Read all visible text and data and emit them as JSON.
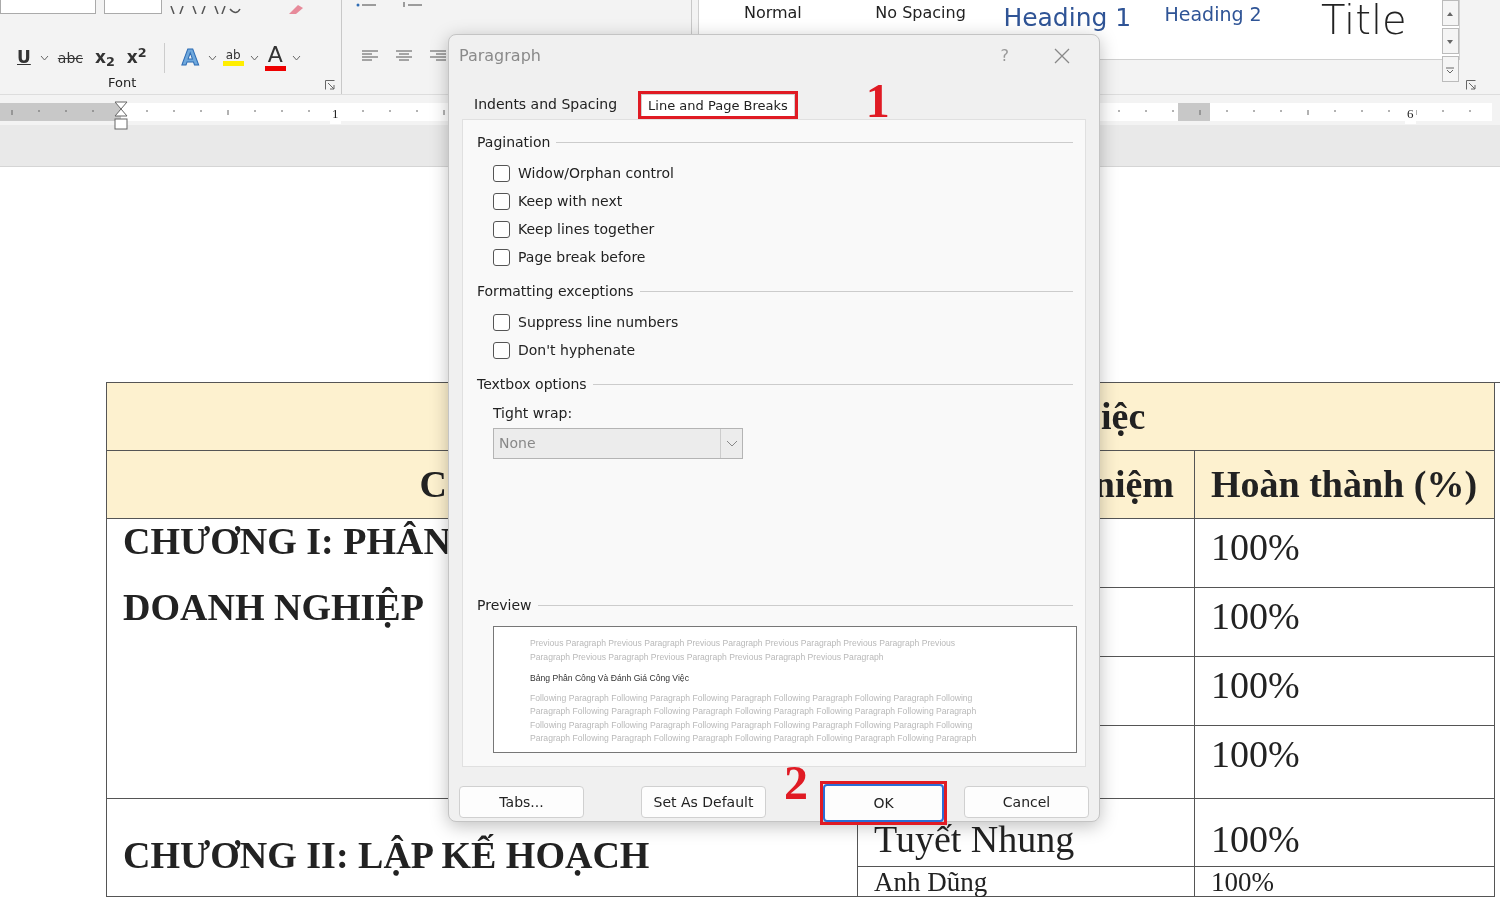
{
  "ribbon": {
    "font_group": {
      "label": "Font",
      "buttons": [
        {
          "kind": "underline",
          "label": "U",
          "has_menu": true
        },
        {
          "kind": "strike",
          "label": "abc",
          "has_menu": false
        },
        {
          "kind": "sub",
          "label": "x$_{2}$",
          "has_menu": false
        },
        {
          "kind": "super",
          "label": "x$^{2}$",
          "has_menu": false
        },
        {
          "kind": "effects",
          "label": "A",
          "has_menu": true
        },
        {
          "kind": "highlight",
          "label": "ab",
          "has_menu": true
        },
        {
          "kind": "fontcolor",
          "label": "A",
          "has_menu": true
        }
      ]
    },
    "styles": [
      {
        "kind": "normal",
        "name": "Normal"
      },
      {
        "kind": "normal",
        "name": "No Spacing"
      },
      {
        "kind": "heading1",
        "name": "Heading 1"
      },
      {
        "kind": "heading2",
        "name": "Heading 2"
      },
      {
        "kind": "title",
        "name": "Title"
      }
    ]
  },
  "ruler": {
    "numbers": [
      "1",
      "6"
    ]
  },
  "document": {
    "table": {
      "title_fragment": "iệc",
      "headers": [
        "C",
        "niệm",
        "Hoàn thành (%)"
      ],
      "sections": [
        {
          "chapter_lines": [
            "CHƯƠNG I: PHÂN",
            "DOANH NGHIỆP"
          ],
          "rows": [
            {
              "completion": "100%"
            },
            {
              "completion": "100%"
            },
            {
              "completion": "100%"
            },
            {
              "completion": "100%"
            }
          ]
        },
        {
          "chapter_lines": [
            "CHƯƠNG II: LẬP KẾ HOẠCH"
          ],
          "rows": [
            {
              "person": "Tuyết Nhung",
              "completion": "100%"
            },
            {
              "person": "Anh Dũng",
              "completion": "100%"
            }
          ]
        }
      ]
    }
  },
  "dialog": {
    "title": "Paragraph",
    "help": "?",
    "tabs": [
      {
        "label": "Indents and Spacing",
        "selected": false
      },
      {
        "label": "Line and Page Breaks",
        "selected": true,
        "annotation": "1"
      }
    ],
    "sections": [
      {
        "kind": "checks",
        "title": "Pagination",
        "options": [
          {
            "label": "Widow/Orphan control",
            "checked": false
          },
          {
            "label": "Keep with next",
            "checked": false
          },
          {
            "label": "Keep lines together",
            "checked": false
          },
          {
            "label": "Page break before",
            "checked": false
          }
        ]
      },
      {
        "kind": "checks",
        "title": "Formatting exceptions",
        "options": [
          {
            "label": "Suppress line numbers",
            "checked": false
          },
          {
            "label": "Don't hyphenate",
            "checked": false
          }
        ]
      },
      {
        "kind": "field",
        "title": "Textbox options",
        "field": {
          "label": "Tight wrap:",
          "value": "None",
          "disabled": true
        }
      }
    ],
    "preview": {
      "title": "Preview",
      "previous_lines": [
        "Previous Paragraph Previous Paragraph Previous Paragraph Previous Paragraph Previous Paragraph Previous",
        "Paragraph Previous Paragraph Previous Paragraph Previous Paragraph Previous Paragraph"
      ],
      "current": "Bảng Phân Công Và Đánh Giá Công Việc",
      "following_lines": [
        "Following Paragraph Following Paragraph Following Paragraph Following Paragraph Following Paragraph Following",
        "Paragraph Following Paragraph Following Paragraph Following Paragraph Following Paragraph Following Paragraph",
        "Following Paragraph Following Paragraph Following Paragraph Following Paragraph Following Paragraph Following",
        "Paragraph Following Paragraph Following Paragraph Following Paragraph Following Paragraph Following Paragraph"
      ]
    },
    "buttons": [
      {
        "kind": "left",
        "label": "Tabs..."
      },
      {
        "kind": "right",
        "label": "Set As Default"
      },
      {
        "kind": "default",
        "label": "OK",
        "annotation": "2"
      },
      {
        "kind": "right",
        "label": "Cancel"
      }
    ]
  }
}
